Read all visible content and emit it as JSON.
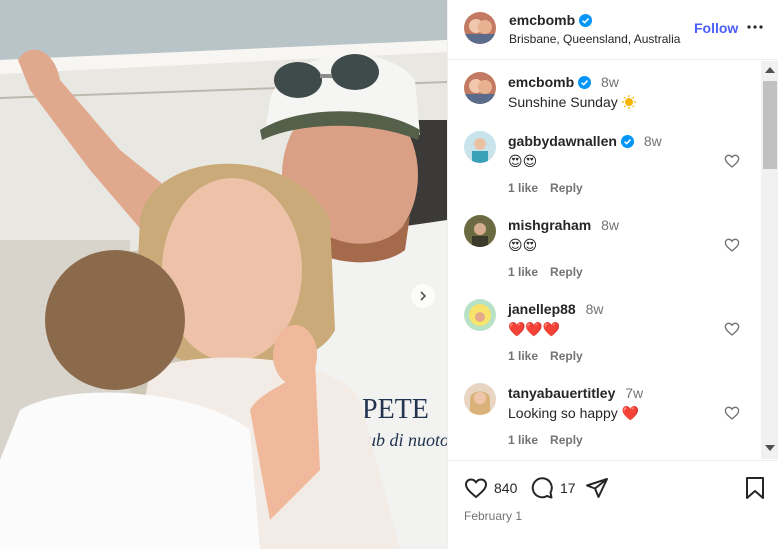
{
  "post": {
    "author": "emcbomb",
    "location": "Brisbane, Queensland, Australia",
    "follow_label": "Follow",
    "caption_user": "emcbomb",
    "caption_time": "8w",
    "caption_text": "Sunshine Sunday",
    "date": "February 1"
  },
  "comments": [
    {
      "user": "gabbydawnallen",
      "verified": true,
      "time": "8w",
      "text": "😍😍",
      "likes": "1 like",
      "reply": "Reply"
    },
    {
      "user": "mishgraham",
      "verified": false,
      "time": "8w",
      "text": "😍😍",
      "likes": "1 like",
      "reply": "Reply"
    },
    {
      "user": "janellep88",
      "verified": false,
      "time": "8w",
      "text": "❤️❤️❤️",
      "likes": "1 like",
      "reply": "Reply"
    },
    {
      "user": "tanyabauertitley",
      "verified": false,
      "time": "7w",
      "text": "Looking so happy ❤️",
      "likes": "1 like",
      "reply": "Reply"
    }
  ],
  "stats": {
    "likes": "840",
    "comments": "17"
  },
  "photo": {
    "shirt_text_1": "PETE",
    "shirt_text_2": "club di nuoto"
  },
  "colors": {
    "accent": "#4a5df9",
    "verified": "#0095f6",
    "heart_red": "#ed4956"
  },
  "icons": [
    "verified-icon",
    "more-icon",
    "heart-icon",
    "comment-icon",
    "share-icon",
    "bookmark-icon",
    "chevron-right-icon"
  ]
}
